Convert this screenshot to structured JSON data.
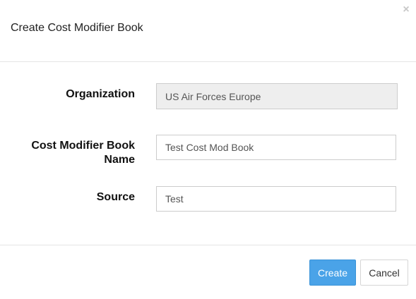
{
  "dialog": {
    "title": "Create Cost Modifier Book",
    "close_glyph": "×"
  },
  "form": {
    "organization": {
      "label": "Organization",
      "value": "US Air Forces Europe"
    },
    "book_name": {
      "label_line1": "Cost Modifier Book",
      "label_line2": "Name",
      "value": "Test Cost Mod Book"
    },
    "source": {
      "label": "Source",
      "value": "Test"
    }
  },
  "footer": {
    "create_label": "Create",
    "cancel_label": "Cancel"
  },
  "colors": {
    "primary": "#4aa3e8",
    "disabled_field": "#eeeeee"
  },
  "icons": {
    "close": "close-icon"
  }
}
